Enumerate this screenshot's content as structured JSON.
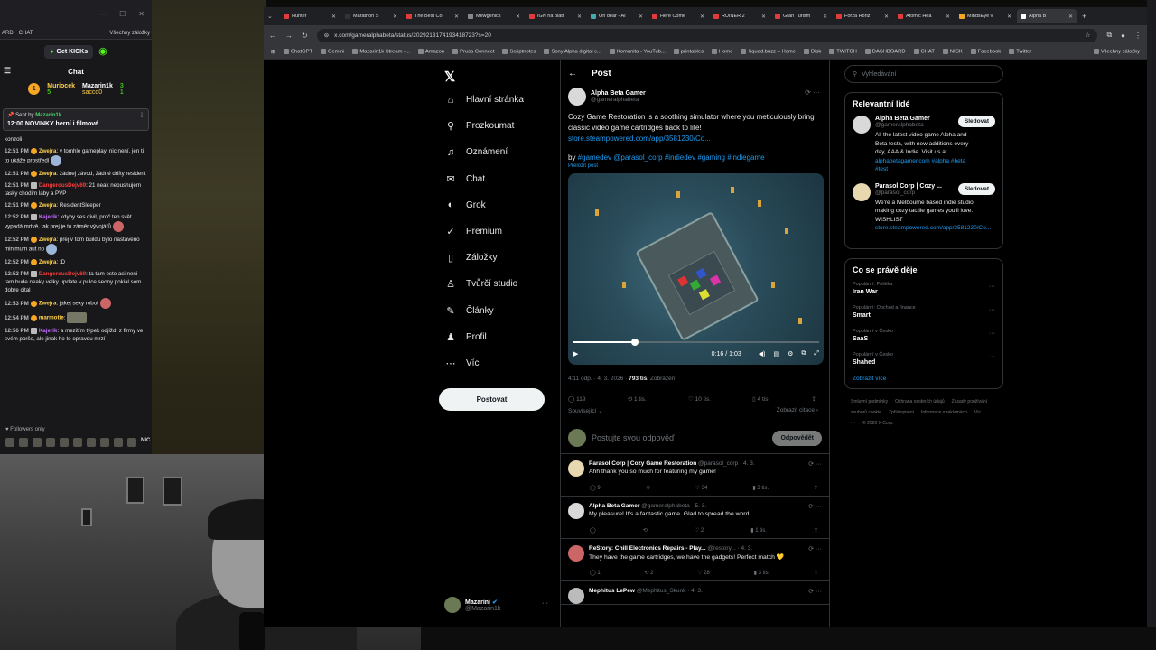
{
  "chat": {
    "tabs": [
      "ARD",
      "CHAT",
      "Všechny záložky"
    ],
    "get_kicks": "Get KICKs",
    "title": "Chat",
    "leaders": [
      {
        "rank": "1",
        "name": "Muriocek",
        "value": "5"
      },
      {
        "rank": "2",
        "name": "Mazarin1k",
        "value": "3"
      },
      {
        "rank": "3",
        "name": "sacco0",
        "value": "1"
      }
    ],
    "pinned": {
      "sent_by": "Sent by",
      "user": "Mazarin1k",
      "title": "12:00 NOVINKY herní i filmové"
    },
    "messages": [
      {
        "time": "",
        "user": "",
        "text": "konzoli",
        "color": ""
      },
      {
        "time": "12:51 PM",
        "user": "Zwejra",
        "text": ": v tomhle gameplayi nic není, jen ti to ukáže prostředí",
        "color": "y"
      },
      {
        "time": "12:51 PM",
        "user": "Zwejra",
        "text": ": žádnej závod, žádné drifty resident",
        "color": "y"
      },
      {
        "time": "12:51 PM",
        "user": "DangerousDejv69",
        "text": ": 21 neak nepushujem tasky chodim laby a PVP",
        "color": "r"
      },
      {
        "time": "12:51 PM",
        "user": "Zwejra",
        "text": ": ResidentSleeper",
        "color": "y"
      },
      {
        "time": "12:52 PM",
        "user": "Kajerik",
        "text": ": kdyby ses divil, proč ten svět vypadá mrtvě, tak prej je to záměr vývojářů",
        "color": "p"
      },
      {
        "time": "12:52 PM",
        "user": "Zwejra",
        "text": ": prej v tom buildu bylo nastaveno minimum aut no",
        "color": "y"
      },
      {
        "time": "12:52 PM",
        "user": "Zwejra",
        "text": ": :D",
        "color": "y"
      },
      {
        "time": "12:52 PM",
        "user": "DangerousDejv69",
        "text": ": ta tam este asi neni tam bude neaky velky update v pulce seony pokial som dobre cital",
        "color": "r"
      },
      {
        "time": "12:53 PM",
        "user": "Zwejra",
        "text": ": jakej sexy robot",
        "color": "y"
      },
      {
        "time": "12:54 PM",
        "user": "marmotie",
        "text": ":",
        "color": "y"
      },
      {
        "time": "12:56 PM",
        "user": "Kajerik",
        "text": ": a mezitím týpek odjíždí z firmy ve svém porše, ale jinak ho to opravdu mrzí",
        "color": "p"
      }
    ],
    "followers_only": "Followers only",
    "emote_label": "NIC"
  },
  "browser": {
    "tabs": [
      {
        "label": "Hunter",
        "color": "#e03a3a"
      },
      {
        "label": "Marathon S",
        "color": "#333"
      },
      {
        "label": "The Best Co",
        "color": "#e03a3a"
      },
      {
        "label": "Mewgenics",
        "color": "#888"
      },
      {
        "label": "IGN na platf",
        "color": "#e03a3a"
      },
      {
        "label": "Oh dear - AI",
        "color": "#4aa"
      },
      {
        "label": "Here Come",
        "color": "#e03a3a"
      },
      {
        "label": "RUINER 2",
        "color": "#e03a3a"
      },
      {
        "label": "Gran Turism",
        "color": "#e03a3a"
      },
      {
        "label": "Forza Horiz",
        "color": "#e03a3a"
      },
      {
        "label": "Atomic Hea",
        "color": "#e03a3a"
      },
      {
        "label": "MindsEye v",
        "color": "#f5a623"
      },
      {
        "label": "Alpha B",
        "color": "#fff"
      }
    ],
    "url": "x.com/gameralphabeta/status/2029213174193418723?s=20",
    "bookmarks": [
      "ChatGPT",
      "Gemini",
      "Mazarin1k Stream -...",
      "Amazon",
      "Prusa Connect",
      "Scriptnotes",
      "Sony Alpha digital c...",
      "Komunita - YouTub...",
      "printables",
      "Home",
      "Squad.buzz – Home",
      "Disk",
      "TWITCH",
      "DASHBOARD",
      "CHAT",
      "NICK",
      "Facebook",
      "Twitter",
      "Všechny záložky"
    ]
  },
  "nav": {
    "items": [
      {
        "label": "Hlavní stránka",
        "icon": "home-icon",
        "glyph": "⌂"
      },
      {
        "label": "Prozkoumat",
        "icon": "search-icon",
        "glyph": "⚲"
      },
      {
        "label": "Oznámení",
        "icon": "bell-icon",
        "glyph": "♫"
      },
      {
        "label": "Chat",
        "icon": "mail-icon",
        "glyph": "✉"
      },
      {
        "label": "Grok",
        "icon": "grok-icon",
        "glyph": "◐"
      },
      {
        "label": "Premium",
        "icon": "premium-icon",
        "glyph": "✓"
      },
      {
        "label": "Záložky",
        "icon": "bookmark-icon",
        "glyph": "▯"
      },
      {
        "label": "Tvůrčí studio",
        "icon": "studio-icon",
        "glyph": "♙"
      },
      {
        "label": "Články",
        "icon": "articles-icon",
        "glyph": "✎"
      },
      {
        "label": "Profil",
        "icon": "profile-icon",
        "glyph": "♟"
      },
      {
        "label": "Víc",
        "icon": "more-icon",
        "glyph": "⋯"
      }
    ],
    "post_button": "Postovat",
    "me_name": "Mazarini",
    "me_handle": "@Mazarin1k"
  },
  "post": {
    "header": "Post",
    "author_name": "Alpha Beta Gamer",
    "author_handle": "@gameralphabeta",
    "text": "Cozy Game Restoration is a soothing simulator where you meticulously bring classic video game cartridges back to life!",
    "link": "store.steampowered.com/app/3581230/Co...",
    "tags_prefix": "by ",
    "tags": "#gamedev @parasol_corp #indiedev #gaming #indiegame",
    "translate": "Přeložit post",
    "video_time": "0:16 / 1:03",
    "video_progress": 0.25,
    "time": "4:11 odp. · 4. 3. 2026 · ",
    "views": "793 tis.",
    "views_label": " Zobrazení",
    "stats": {
      "replies": "119",
      "reposts": "1 tis.",
      "likes": "10 tis.",
      "bookmarks": "4 tis."
    },
    "related": "Související",
    "quotes": "Zobrazit citace",
    "reply_placeholder": "Postujte svou odpověď",
    "reply_button": "Odpovědět"
  },
  "replies": [
    {
      "name": "Parasol Corp | Cozy Game Restoration",
      "handle": "@parasol_corp · 4. 3.",
      "text": "Ahh thank you so much for featuring my game!",
      "acts": [
        "9",
        "",
        "34",
        "3 tis.",
        ""
      ]
    },
    {
      "name": "Alpha Beta Gamer",
      "handle": "@gameralphabeta · 5. 3.",
      "text": "My pleasure! It's a fantastic game. Glad to spread the word!",
      "acts": [
        "",
        "",
        "2",
        "1 tis.",
        ""
      ]
    },
    {
      "name": "ReStory: Chill Electronics Repairs - Play...",
      "handle": "@restory... · 4. 3.",
      "text": "They have the game cartridges, we have the gadgets! Perfect match 💛",
      "acts": [
        "1",
        "2",
        "28",
        "3 tis.",
        ""
      ]
    },
    {
      "name": "Mephitus LePew",
      "handle": "@Mephitus_Skunk · 4. 3.",
      "text": "",
      "acts": []
    }
  ],
  "sidebar": {
    "search_placeholder": "Vyhledávání",
    "relevant_title": "Relevantní lidé",
    "people": [
      {
        "name": "Alpha Beta Gamer",
        "handle": "@gameralphabeta",
        "bio": "All the latest video game Alpha and Beta tests, with new additions every day, AAA & Indie. Visit us at ",
        "bio_link": "alphabetagamer.com #alpha #beta #test",
        "follow": "Sledovat"
      },
      {
        "name": "Parasol Corp | Cozy ...",
        "handle": "@parasol_corp",
        "bio": "We're a Melbourne based indie studio making cozy tactile games you'll love. WISHLIST ",
        "bio_link": "store.steampowered.com/app/3581230/Co...",
        "follow": "Sledovat"
      }
    ],
    "trending_title": "Co se právě děje",
    "trends": [
      {
        "category": "Populární: Politika",
        "name": "Iran War"
      },
      {
        "category": "Populární: Obchod a finance",
        "name": "Smart"
      },
      {
        "category": "Populární v Česko",
        "name": "SaaS"
      },
      {
        "category": "Populární v Česko",
        "name": "Shahed"
      }
    ],
    "show_more": "Zobrazit více",
    "footer": [
      "Smluvní podmínky",
      "Ochrana osobních údajů",
      "Zásady používání souborů cookie",
      "Zpřístupnění",
      "Informace o reklamách",
      "Víc ···",
      "© 2026 X Corp."
    ]
  }
}
